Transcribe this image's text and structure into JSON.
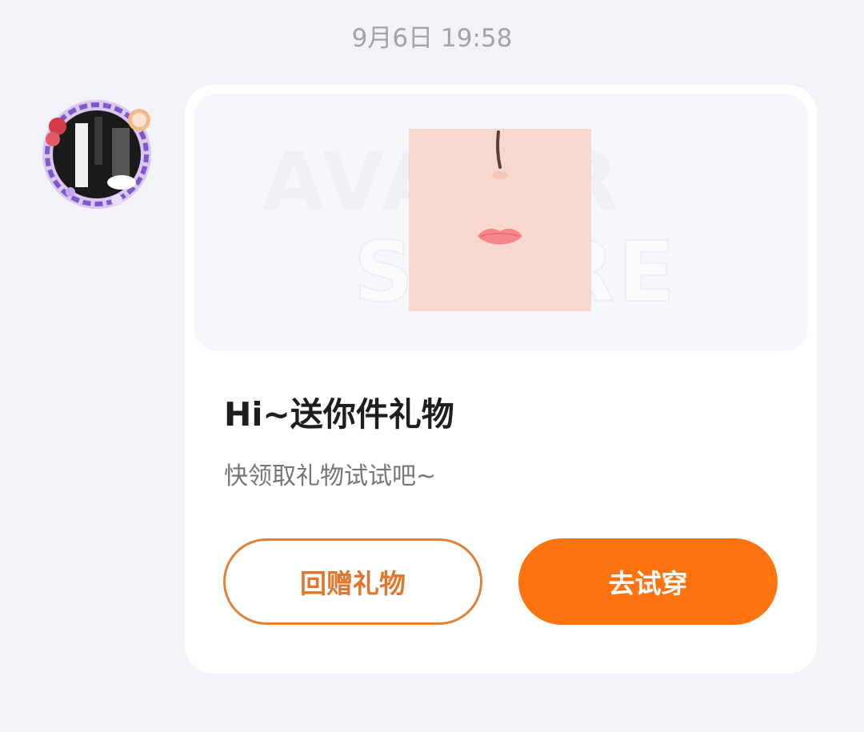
{
  "message": {
    "timestamp": "9月6日 19:58"
  },
  "card": {
    "banner_watermark_line1": "AVATAR",
    "banner_watermark_line2": "STORE",
    "title": "Hi~送你件礼物",
    "subtitle": "快领取礼物试试吧~",
    "return_gift_label": "回赠礼物",
    "try_on_label": "去试穿"
  },
  "colors": {
    "accent": "#ff7310",
    "outline": "#e2813a",
    "page_bg": "#f2f3f7"
  },
  "icons": {
    "avatar": "user-avatar",
    "gift_item": "face-makeup-item"
  }
}
